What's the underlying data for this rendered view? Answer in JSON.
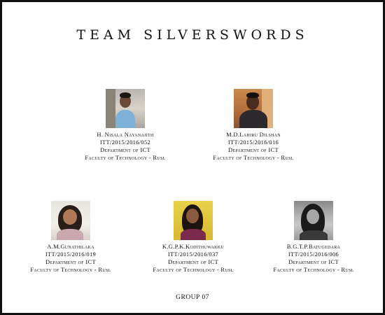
{
  "title": "TEAM SILVERSWORDS",
  "members": [
    {
      "name": "H. Nisala Nayanajith",
      "id": "ITT/2015/2016/052",
      "department": "Department of ICT",
      "faculty": "Faculty of Technology - Rusl",
      "photo_label": "Photo of H. Nisala Nayanajith"
    },
    {
      "name": "M.D.Lahiru Dilshan",
      "id": "ITT/2015/2016/016",
      "department": "Department of ICT",
      "faculty": "Faculty of Technology - Rusl",
      "photo_label": "Photo of M.D.Lahiru Dilshan"
    },
    {
      "name": "A.M.Gunathilaka",
      "id": "ITT/2015/2016/019",
      "department": "Department of ICT",
      "faculty": "Faculty of Technology - Rusl",
      "photo_label": "Photo of A.M.Gunathilaka"
    },
    {
      "name": "K.G.P.K.Kodithuwakku",
      "id": "ITT/2015/2016/037",
      "department": "Department of ICT",
      "faculty": "Faculty of Technology - Rusl",
      "photo_label": "Photo of K.G.P.K.Kodithuwakku"
    },
    {
      "name": "B.G.T.P.Batugedara",
      "id": "ITT/2015/2016/006",
      "department": "Department of ICT",
      "faculty": "Faculty of Technology - Rusl",
      "photo_label": "Photo of B.G.T.P.Batugedara"
    }
  ],
  "footer": "GROUP 07",
  "colors": {
    "border": "#111111",
    "text": "#111111",
    "background": "#ffffff"
  }
}
